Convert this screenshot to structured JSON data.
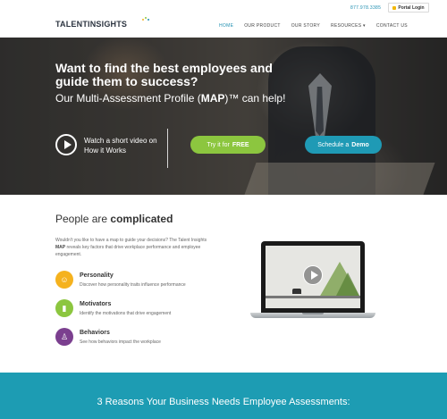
{
  "header": {
    "logo": "TALENTINSIGHTS",
    "phone": "877.978.3385",
    "portal_login": "Portal Login",
    "nav": [
      "HOME",
      "OUR PRODUCT",
      "OUR STORY",
      "RESOURCES ▾",
      "CONTACT US"
    ],
    "active_nav": "HOME"
  },
  "hero": {
    "title": "Want to find the best employees and guide them to success?",
    "sub_prefix": "Our Multi-Assessment Profile (",
    "sub_bold": "MAP",
    "sub_suffix": ")™ can help!",
    "video_text": "Watch a short video on How it Works",
    "try_prefix": "Try it for",
    "try_bold": "FREE",
    "demo_prefix": "Schedule a",
    "demo_bold": "Demo"
  },
  "complicated": {
    "title_prefix": "People are",
    "title_bold": "complicated",
    "intro_a": "Wouldn't you like to have a map to guide your decisions? The Talent Insights",
    "intro_bold": "MAP",
    "intro_b": "reveals key factors that drive workplace performance and employee engagement.",
    "features": [
      {
        "title": "Personality",
        "desc": "Discover how personality traits influence performance",
        "icon": "personality-icon",
        "color": "#f5b21e"
      },
      {
        "title": "Motivators",
        "desc": "Identify the motivations that drive engagement",
        "icon": "battery-icon",
        "color": "#8cc63f"
      },
      {
        "title": "Behaviors",
        "desc": "See how behaviors impact the workplace",
        "icon": "person-icon",
        "color": "#7b3f8f"
      }
    ]
  },
  "banner": {
    "text": "3 Reasons Your Business Needs Employee Assessments:"
  },
  "colors": {
    "accent": "#1f8fb1",
    "green": "#8cc63f",
    "teal": "#1d9cb3"
  }
}
